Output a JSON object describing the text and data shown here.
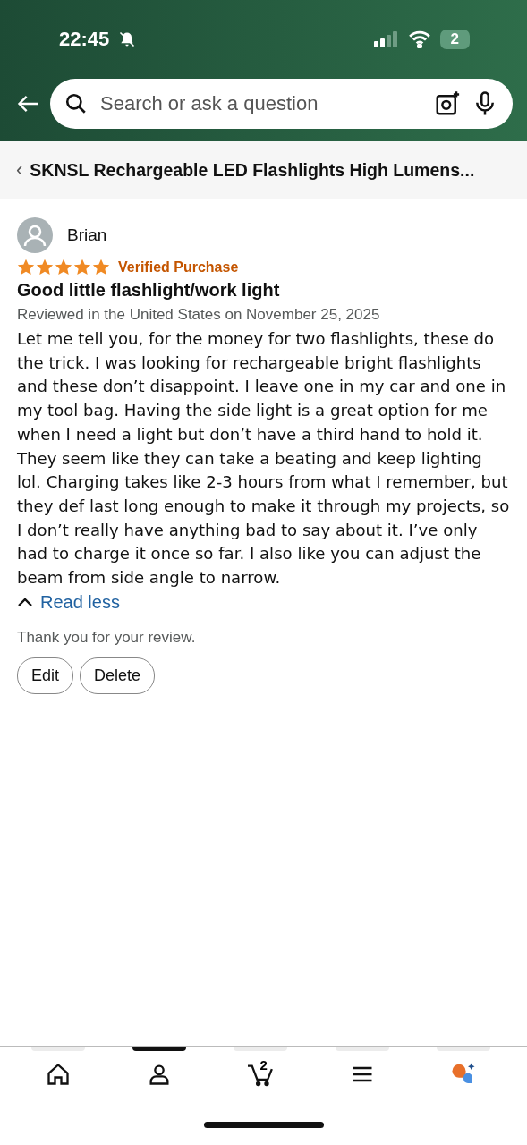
{
  "status_bar": {
    "time": "22:45",
    "battery": "2"
  },
  "search": {
    "placeholder": "Search or ask a question"
  },
  "breadcrumb": {
    "arrow": "‹",
    "title": "SKNSL Rechargeable LED Flashlights High Lumens..."
  },
  "review": {
    "author": "Brian",
    "stars": 5,
    "badge": "Verified Purchase",
    "title": "Good little flashlight/work light",
    "meta": "Reviewed in the United States on November 25, 2025",
    "body": "Let me tell you, for the money for two flashlights, these do the trick. I was looking for rechargeable bright flashlights and these don’t disappoint. I leave one in my car and one in my tool bag. Having the side light is a great option for me when I need a light but don’t have a third hand to hold it. They seem like they can take a beating and keep lighting lol. Charging takes like 2-3 hours from what I remember, but they def last long enough to make it through my projects, so I don’t really have anything bad to say about it. I’ve only had to charge it once so far. I also like you can adjust the beam from side angle to narrow.",
    "toggle": "Read less",
    "thanks": "Thank you for your review.",
    "buttons": [
      "Edit",
      "Delete"
    ]
  },
  "nav": [
    {
      "kind": "home",
      "selected": false
    },
    {
      "kind": "account",
      "selected": true
    },
    {
      "kind": "cart",
      "selected": false,
      "count": "2"
    },
    {
      "kind": "menu",
      "selected": false
    },
    {
      "kind": "assistant",
      "selected": false
    }
  ]
}
